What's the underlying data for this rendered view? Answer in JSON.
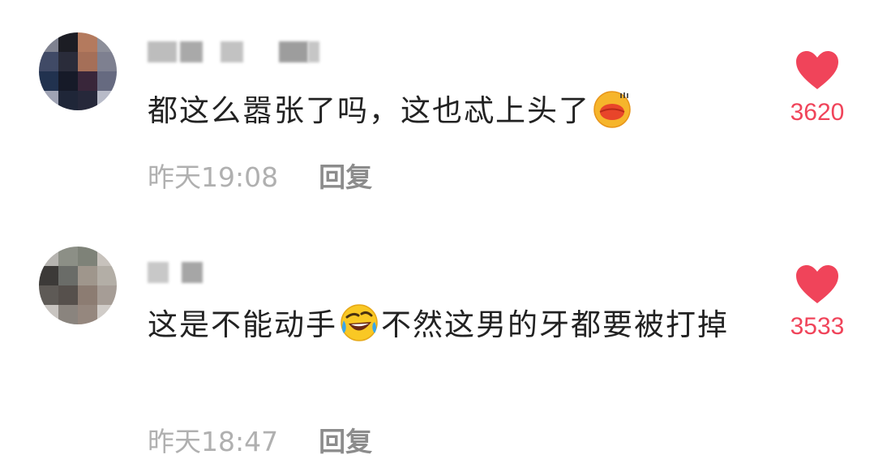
{
  "comments": [
    {
      "username_visible": "",
      "text_before_emoji": "都这么嚣张了吗，这也忒上头了",
      "emoji": "kiss-lips-emoji",
      "text_after_emoji": "",
      "time": "昨天19:08",
      "reply_label": "回复",
      "likes": "3620"
    },
    {
      "username_visible": "",
      "text_before_emoji": "这是不能动手",
      "emoji": "rolling-laughing-emoji",
      "text_after_emoji": "不然这男的牙都要被打掉",
      "time": "昨天18:47",
      "reply_label": "回复",
      "likes": "3533"
    }
  ],
  "colors": {
    "like_red": "#f0445a",
    "meta_gray": "#b0b0b0",
    "reply_gray": "#8c8c8c",
    "text": "#222222"
  }
}
